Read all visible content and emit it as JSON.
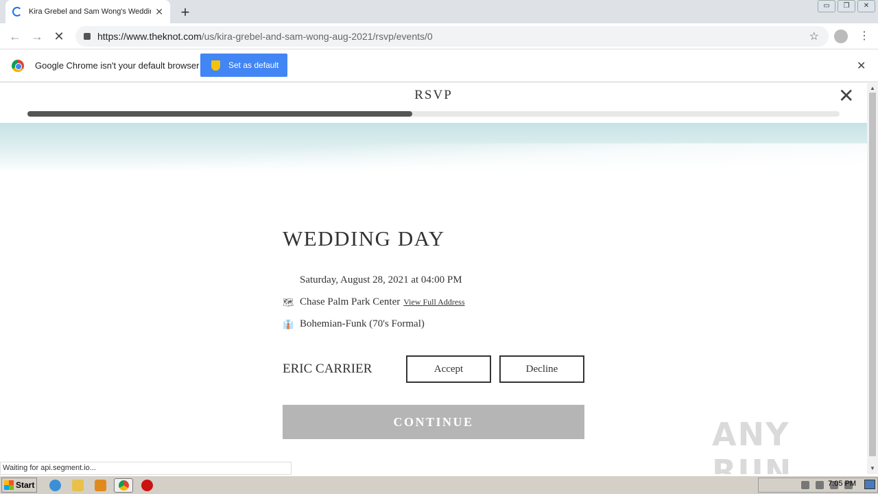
{
  "browser": {
    "tab_title": "Kira Grebel and Sam Wong's Wedding",
    "tab_close": "✕",
    "new_tab": "+",
    "window_controls": [
      "▭",
      "❐",
      "✕"
    ],
    "url_host": "https://www.theknot.com",
    "url_path": "/us/kira-grebel-and-sam-wong-aug-2021/rsvp/events/0",
    "back": "←",
    "forward": "→",
    "stop": "✕",
    "star": "☆",
    "menu": "⋮"
  },
  "infobar": {
    "message": "Google Chrome isn't your default browser",
    "button_label": "Set as default",
    "close": "✕"
  },
  "rsvp": {
    "header": "RSVP",
    "close": "✕",
    "progress": 0.474,
    "event_title": "WEDDING DAY",
    "date_time": "Saturday, August 28, 2021 at 04:00 PM",
    "venue": "Chase Palm Park Center",
    "view_address": "View Full Address",
    "dress_code": "Bohemian-Funk (70's Formal)",
    "guest_name": "ERIC CARRIER",
    "accept_label": "Accept",
    "decline_label": "Decline",
    "continue_label": "CONTINUE"
  },
  "status_bar": "Waiting for api.segment.io...",
  "watermark": "ANY RUN",
  "taskbar": {
    "start_label": "Start",
    "clock": "7:05 PM"
  },
  "colors": {
    "progress_fill": "#555555",
    "continue_disabled": "#b5b5b5",
    "chrome_blue": "#4285f4"
  }
}
